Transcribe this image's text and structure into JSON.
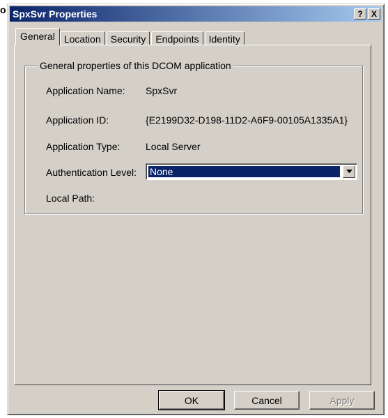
{
  "background": {
    "partial_text": "o"
  },
  "window": {
    "title": "SpxSvr Properties",
    "help_label": "?",
    "close_label": "X"
  },
  "tabs": [
    {
      "label": "General",
      "active": true
    },
    {
      "label": "Location",
      "active": false
    },
    {
      "label": "Security",
      "active": false
    },
    {
      "label": "Endpoints",
      "active": false
    },
    {
      "label": "Identity",
      "active": false
    }
  ],
  "group": {
    "legend": "General properties of this DCOM application"
  },
  "fields": {
    "app_name_label": "Application Name:",
    "app_name_value": "SpxSvr",
    "app_id_label": "Application ID:",
    "app_id_value": "{E2199D32-D198-11D2-A6F9-00105A1335A1}",
    "app_type_label": "Application Type:",
    "app_type_value": "Local Server",
    "auth_label": "Authentication Level:",
    "auth_value": "None",
    "local_path_label": "Local Path:"
  },
  "buttons": {
    "ok": "OK",
    "cancel": "Cancel",
    "apply": "Apply"
  },
  "colors": {
    "titlebar_start": "#0a246a",
    "titlebar_end": "#a6caf0",
    "face": "#d4d0c8",
    "selection": "#0a246a"
  }
}
